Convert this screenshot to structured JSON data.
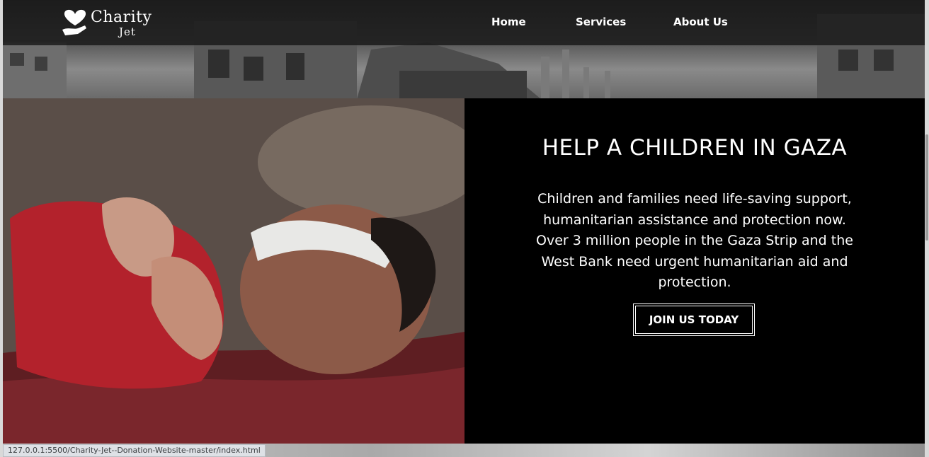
{
  "brand": {
    "line1": "Charity",
    "line2": "Jet",
    "icon": "hands-heart-icon"
  },
  "nav": {
    "items": [
      "Home",
      "Services",
      "About Us"
    ]
  },
  "hero": {
    "title": "HELP A CHILDREN IN GAZA",
    "body": "Children and families need life-saving support, humanitarian assistance and protection now. Over 3 million people in the Gaza Strip and the West Bank need urgent humanitarian aid and protection.",
    "cta_label": "JOIN US TODAY"
  },
  "status_url": "127.0.0.1:5500/Charity-Jet--Donation-Website-master/index.html",
  "colors": {
    "panel_bg": "#000000",
    "navbar_bg": "#141414",
    "text": "#ffffff"
  }
}
